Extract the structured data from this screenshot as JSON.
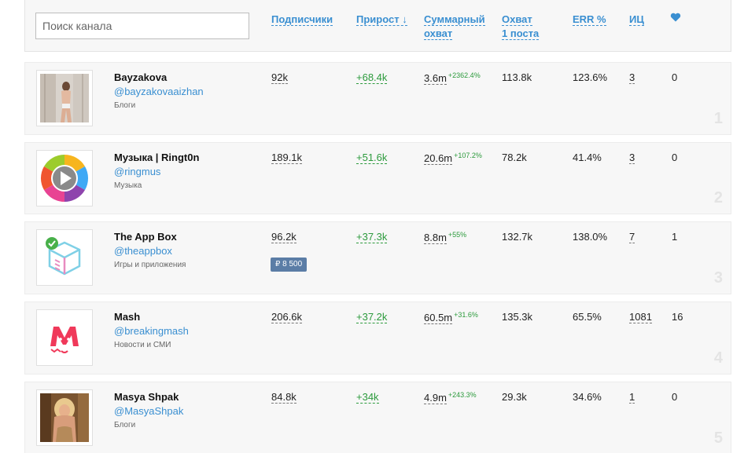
{
  "search": {
    "placeholder": "Поиск канала"
  },
  "columns": {
    "subscribers": "Подписчики",
    "growth": "Прирост ↓",
    "total_reach_1": "Суммарный",
    "total_reach_2": "охват",
    "post_reach_1": "Охват",
    "post_reach_2": "1 поста",
    "err": "ERR %",
    "ic": "ИЦ"
  },
  "accent_color": "#3a8fd1",
  "channels": [
    {
      "rank": "1",
      "name": "Bayzakova",
      "handle": "@bayzakovaaizhan",
      "category": "Блоги",
      "subscribers": "92k",
      "growth": "+68.4k",
      "total_reach": "3.6m",
      "total_reach_delta": "+2362.4%",
      "post_reach": "113.8k",
      "err": "123.6%",
      "ic": "3",
      "likes": "0"
    },
    {
      "rank": "2",
      "name": "Музыка | Ringt0n",
      "handle": "@ringmus",
      "category": "Музыка",
      "subscribers": "189.1k",
      "growth": "+51.6k",
      "total_reach": "20.6m",
      "total_reach_delta": "+107.2%",
      "post_reach": "78.2k",
      "err": "41.4%",
      "ic": "3",
      "likes": "0"
    },
    {
      "rank": "3",
      "name": "The App Box",
      "handle": "@theappbox",
      "category": "Игры и приложения",
      "price": "₽  8 500",
      "subscribers": "96.2k",
      "growth": "+37.3k",
      "total_reach": "8.8m",
      "total_reach_delta": "+55%",
      "post_reach": "132.7k",
      "err": "138.0%",
      "ic": "7",
      "likes": "1"
    },
    {
      "rank": "4",
      "name": "Mash",
      "handle": "@breakingmash",
      "category": "Новости и СМИ",
      "subscribers": "206.6k",
      "growth": "+37.2k",
      "total_reach": "60.5m",
      "total_reach_delta": "+31.6%",
      "post_reach": "135.3k",
      "err": "65.5%",
      "ic": "1081",
      "likes": "16"
    },
    {
      "rank": "5",
      "name": "Masya Shpak",
      "handle": "@MasyaShpak",
      "category": "Блоги",
      "subscribers": "84.8k",
      "growth": "+34k",
      "total_reach": "4.9m",
      "total_reach_delta": "+243.3%",
      "post_reach": "29.3k",
      "err": "34.6%",
      "ic": "1",
      "likes": "0"
    }
  ]
}
